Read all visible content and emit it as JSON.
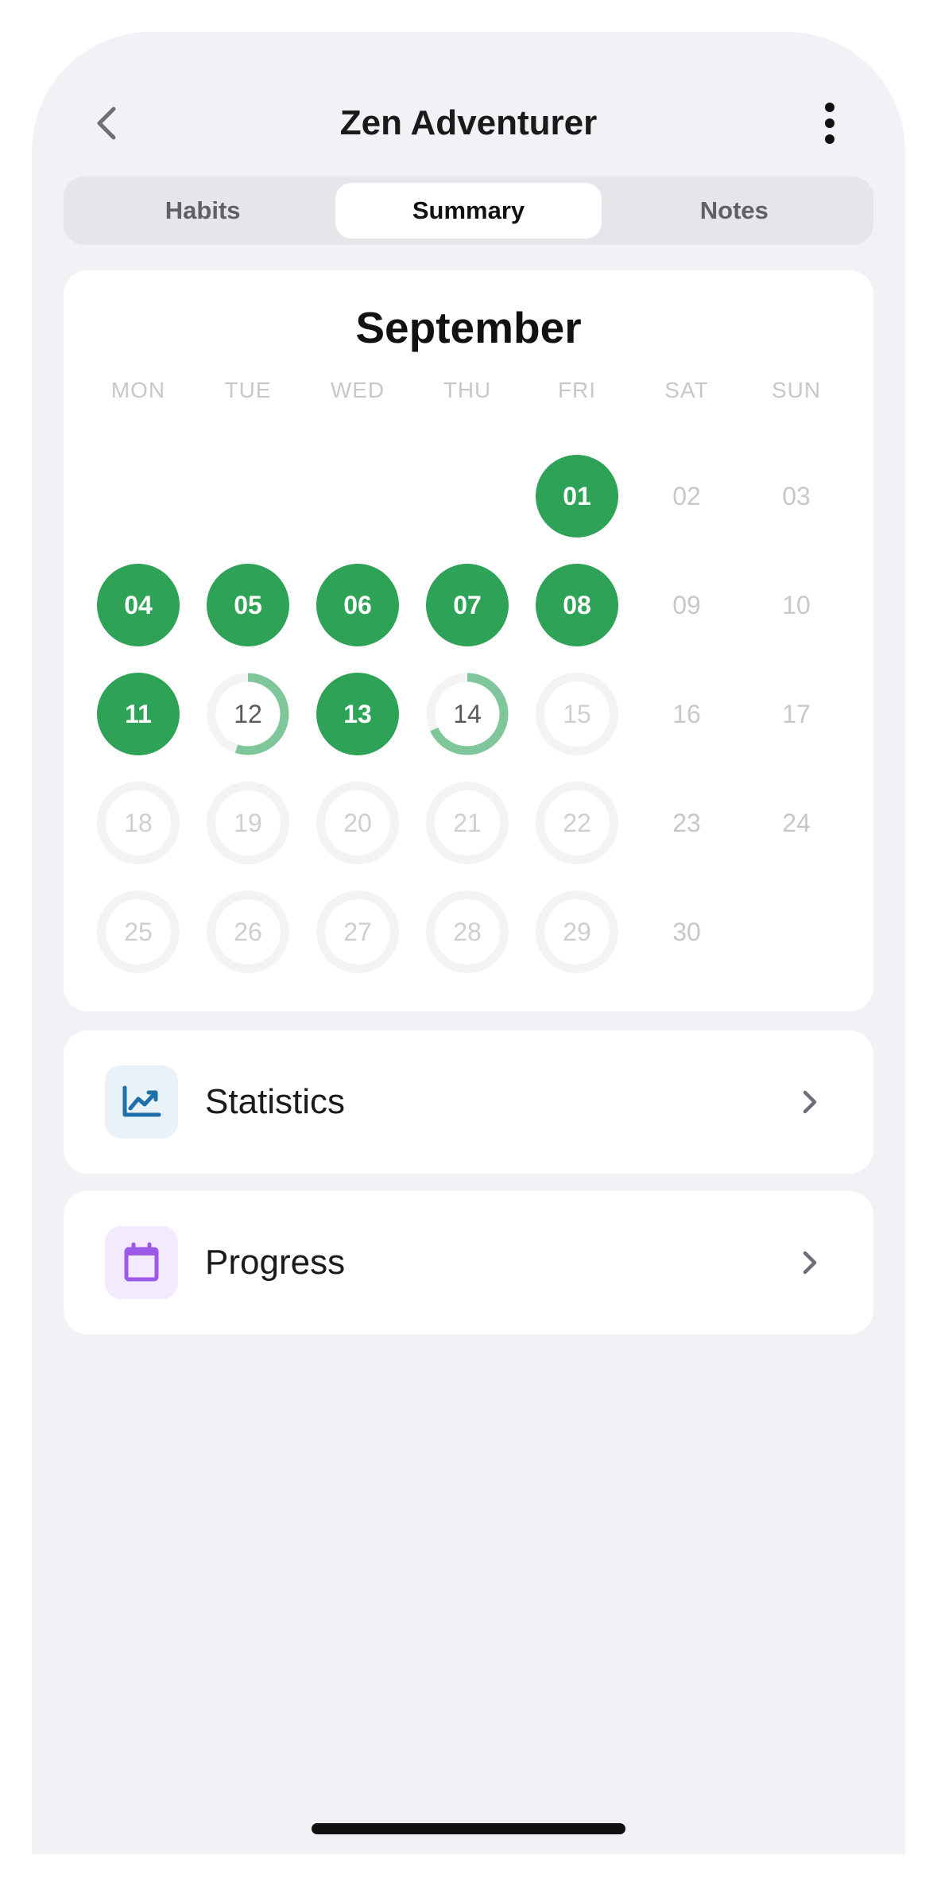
{
  "header": {
    "title": "Zen Adventurer",
    "back_icon": "chevron-left-icon",
    "more_icon": "more-vertical-icon"
  },
  "tabs": [
    {
      "label": "Habits",
      "active": false
    },
    {
      "label": "Summary",
      "active": true
    },
    {
      "label": "Notes",
      "active": false
    }
  ],
  "calendar": {
    "month": "September",
    "weekdays": [
      "MON",
      "TUE",
      "WED",
      "THU",
      "FRI",
      "SAT",
      "SUN"
    ],
    "days": [
      {
        "label": "01",
        "status": "done"
      },
      {
        "label": "02",
        "status": "weekend"
      },
      {
        "label": "03",
        "status": "weekend"
      },
      {
        "label": "04",
        "status": "done"
      },
      {
        "label": "05",
        "status": "done"
      },
      {
        "label": "06",
        "status": "done"
      },
      {
        "label": "07",
        "status": "done"
      },
      {
        "label": "08",
        "status": "done"
      },
      {
        "label": "09",
        "status": "weekend"
      },
      {
        "label": "10",
        "status": "weekend"
      },
      {
        "label": "11",
        "status": "done"
      },
      {
        "label": "12",
        "status": "partial",
        "progress": 0.55
      },
      {
        "label": "13",
        "status": "done"
      },
      {
        "label": "14",
        "status": "partial",
        "progress": 0.68
      },
      {
        "label": "15",
        "status": "empty"
      },
      {
        "label": "16",
        "status": "weekend"
      },
      {
        "label": "17",
        "status": "weekend"
      },
      {
        "label": "18",
        "status": "empty"
      },
      {
        "label": "19",
        "status": "empty"
      },
      {
        "label": "20",
        "status": "empty"
      },
      {
        "label": "21",
        "status": "empty"
      },
      {
        "label": "22",
        "status": "empty"
      },
      {
        "label": "23",
        "status": "weekend"
      },
      {
        "label": "24",
        "status": "weekend"
      },
      {
        "label": "25",
        "status": "empty"
      },
      {
        "label": "26",
        "status": "empty"
      },
      {
        "label": "27",
        "status": "empty"
      },
      {
        "label": "28",
        "status": "empty"
      },
      {
        "label": "29",
        "status": "empty"
      },
      {
        "label": "30",
        "status": "weekend"
      }
    ],
    "first_weekday_index": 4
  },
  "menu": {
    "statistics": {
      "label": "Statistics",
      "icon": "chart-trend-icon",
      "icon_color": "#1f6fa8",
      "icon_bg": "#e9f2f8"
    },
    "progress": {
      "label": "Progress",
      "icon": "calendar-icon",
      "icon_color": "#9b59e6",
      "icon_bg": "#f3ebfd"
    }
  },
  "colors": {
    "done": "#2ea357",
    "partial_ring": "#7fc79a",
    "empty_ring": "#f3f3f3"
  }
}
